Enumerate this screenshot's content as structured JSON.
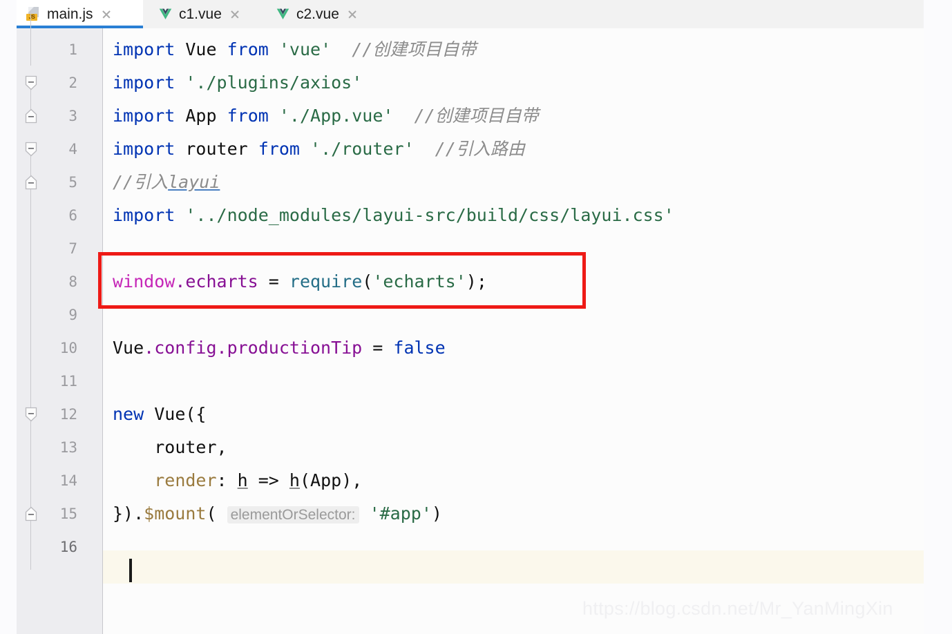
{
  "tabs": [
    {
      "label": "main.js",
      "icon": "js-file-icon",
      "active": true,
      "close_icon": "close-icon"
    },
    {
      "label": "c1.vue",
      "icon": "vue-file-icon",
      "active": false,
      "close_icon": "close-icon"
    },
    {
      "label": "c2.vue",
      "icon": "vue-file-icon",
      "active": false,
      "close_icon": "close-icon"
    }
  ],
  "editor": {
    "line_numbers": [
      "1",
      "2",
      "3",
      "4",
      "5",
      "6",
      "7",
      "8",
      "9",
      "10",
      "11",
      "12",
      "13",
      "14",
      "15",
      "16"
    ],
    "current_line": "16",
    "caret_line": 16,
    "fold_markers": [
      {
        "line": 2,
        "icon": "fold-collapse-icon"
      },
      {
        "line": 3,
        "icon": "fold-expand-icon"
      },
      {
        "line": 4,
        "icon": "fold-collapse-icon"
      },
      {
        "line": 5,
        "icon": "fold-expand-icon"
      },
      {
        "line": 12,
        "icon": "fold-collapse-icon"
      },
      {
        "line": 15,
        "icon": "fold-expand-icon"
      }
    ],
    "lines": [
      {
        "n": "1",
        "text": "import Vue from 'vue'  //创建项目自带"
      },
      {
        "n": "2",
        "text": "import './plugins/axios'"
      },
      {
        "n": "3",
        "text": "import App from './App.vue'  //创建项目自带"
      },
      {
        "n": "4",
        "text": "import router from './router'  //引入路由"
      },
      {
        "n": "5",
        "text": "//引入layui"
      },
      {
        "n": "6",
        "text": "import '../node_modules/layui-src/build/css/layui.css'"
      },
      {
        "n": "7",
        "text": ""
      },
      {
        "n": "8",
        "text": "window.echarts = require('echarts');"
      },
      {
        "n": "9",
        "text": ""
      },
      {
        "n": "10",
        "text": "Vue.config.productionTip = false"
      },
      {
        "n": "11",
        "text": ""
      },
      {
        "n": "12",
        "text": "new Vue({"
      },
      {
        "n": "13",
        "text": "    router,"
      },
      {
        "n": "14",
        "text": "    render: h => h(App),"
      },
      {
        "n": "15",
        "text": "}).$mount( elementOrSelector: '#app')"
      },
      {
        "n": "16",
        "text": ""
      }
    ],
    "tokens": {
      "l1": {
        "kw1": "import",
        "sp1": " ",
        "id1": "Vue",
        "sp2": " ",
        "kw2": "from",
        "sp3": " ",
        "str": "'vue'",
        "cmt": "  //创建项目自带"
      },
      "l2": {
        "kw1": "import",
        "sp1": " ",
        "str": "'./plugins/axios'"
      },
      "l3": {
        "kw1": "import",
        "sp1": " ",
        "id1": "App",
        "sp2": " ",
        "kw2": "from",
        "sp3": " ",
        "str": "'./App.vue'",
        "cmt": "  //创建项目自带"
      },
      "l4": {
        "kw1": "import",
        "sp1": " ",
        "id1": "router",
        "sp2": " ",
        "kw2": "from",
        "sp3": " ",
        "str": "'./router'",
        "cmt": "  //引入路由"
      },
      "l5": {
        "cmt_pre": "//引入",
        "cmt_word": "layui"
      },
      "l6": {
        "kw1": "import",
        "sp1": " ",
        "str": "'../node_modules/layui-src/build/css/layui.css'"
      },
      "l8": {
        "global": "window",
        "field": ".echarts",
        "eq": " = ",
        "fn": "require",
        "paren_open": "(",
        "str": "'echarts'",
        "paren_close": ");"
      },
      "l10": {
        "id1": "Vue",
        "field": ".config.productionTip",
        "eq": " = ",
        "kw": "false"
      },
      "l12": {
        "kw": "new",
        "sp": " ",
        "id1": "Vue({"
      },
      "l13": {
        "indent": "    ",
        "id1": "router,"
      },
      "l14": {
        "indent": "    ",
        "prop": "render",
        "colon": ": ",
        "p1": "h",
        "arrow": " => ",
        "p2": "h",
        "rest": "(App),"
      },
      "l15": {
        "close": "}).",
        "mount": "$mount",
        "paren": "( ",
        "hint": "elementOrSelector:",
        "sp": " ",
        "str": "'#app'",
        "end": ")"
      }
    }
  },
  "annotation": {
    "type": "red-rectangle-highlight",
    "target_line": "8",
    "color": "#ee1a16"
  },
  "watermark": {
    "text": "https://blog.csdn.net/Mr_YanMingXin"
  },
  "colors": {
    "keyword": "#0033b3",
    "string": "#2a6b46",
    "comment": "#8c8c8c",
    "field": "#871094",
    "global": "#c526b7",
    "function": "#246e87",
    "property": "#9a7b3f",
    "tab_active_underline": "#2a7fd4",
    "current_line_bg": "#fbf8ec",
    "gutter_bg": "#ededf0",
    "editor_bg": "#fcfcfc",
    "vue_green": "#41b883"
  }
}
